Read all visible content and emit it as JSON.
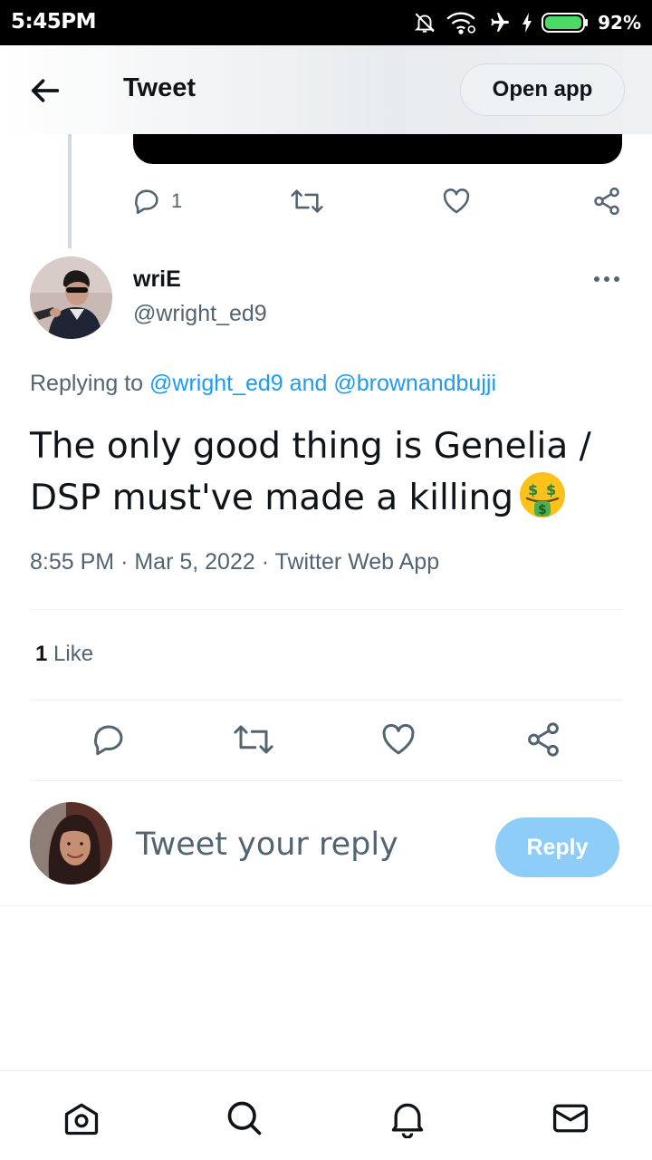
{
  "status_bar": {
    "time": "5:45PM",
    "battery_percent": "92%",
    "icons": [
      "notifications-off-icon",
      "wifi-icon",
      "airplane-mode-icon",
      "charging-icon",
      "battery-icon"
    ]
  },
  "header": {
    "title": "Tweet",
    "open_app_label": "Open app",
    "back_icon": "arrow-left-icon"
  },
  "parent_tweet": {
    "reply_count": "1",
    "icons": [
      "reply-icon",
      "retweet-icon",
      "like-icon",
      "share-icon"
    ]
  },
  "tweet": {
    "author_name": "wriE",
    "author_handle": "@wright_ed9",
    "replying_prefix": "Replying to",
    "replying_user1": "@wright_ed9",
    "replying_and": "and",
    "replying_user2": "@brownandbujji",
    "text": "The only good thing is Genelia / DSP must've made a killing",
    "emoji": "money-mouth-face",
    "time": "8:55 PM",
    "date": "Mar 5, 2022",
    "source": "Twitter Web App",
    "meta_separator": "·",
    "like_count": "1",
    "like_label": "Like"
  },
  "composer": {
    "placeholder": "Tweet your reply",
    "reply_button_label": "Reply"
  },
  "bottom_nav": {
    "items": [
      "home-icon",
      "search-icon",
      "notifications-icon",
      "messages-icon"
    ]
  },
  "colors": {
    "accent": "#1d9bf0",
    "reply_button": "#8ecdf8",
    "secondary_text": "#536471",
    "primary_text": "#0f1419"
  }
}
